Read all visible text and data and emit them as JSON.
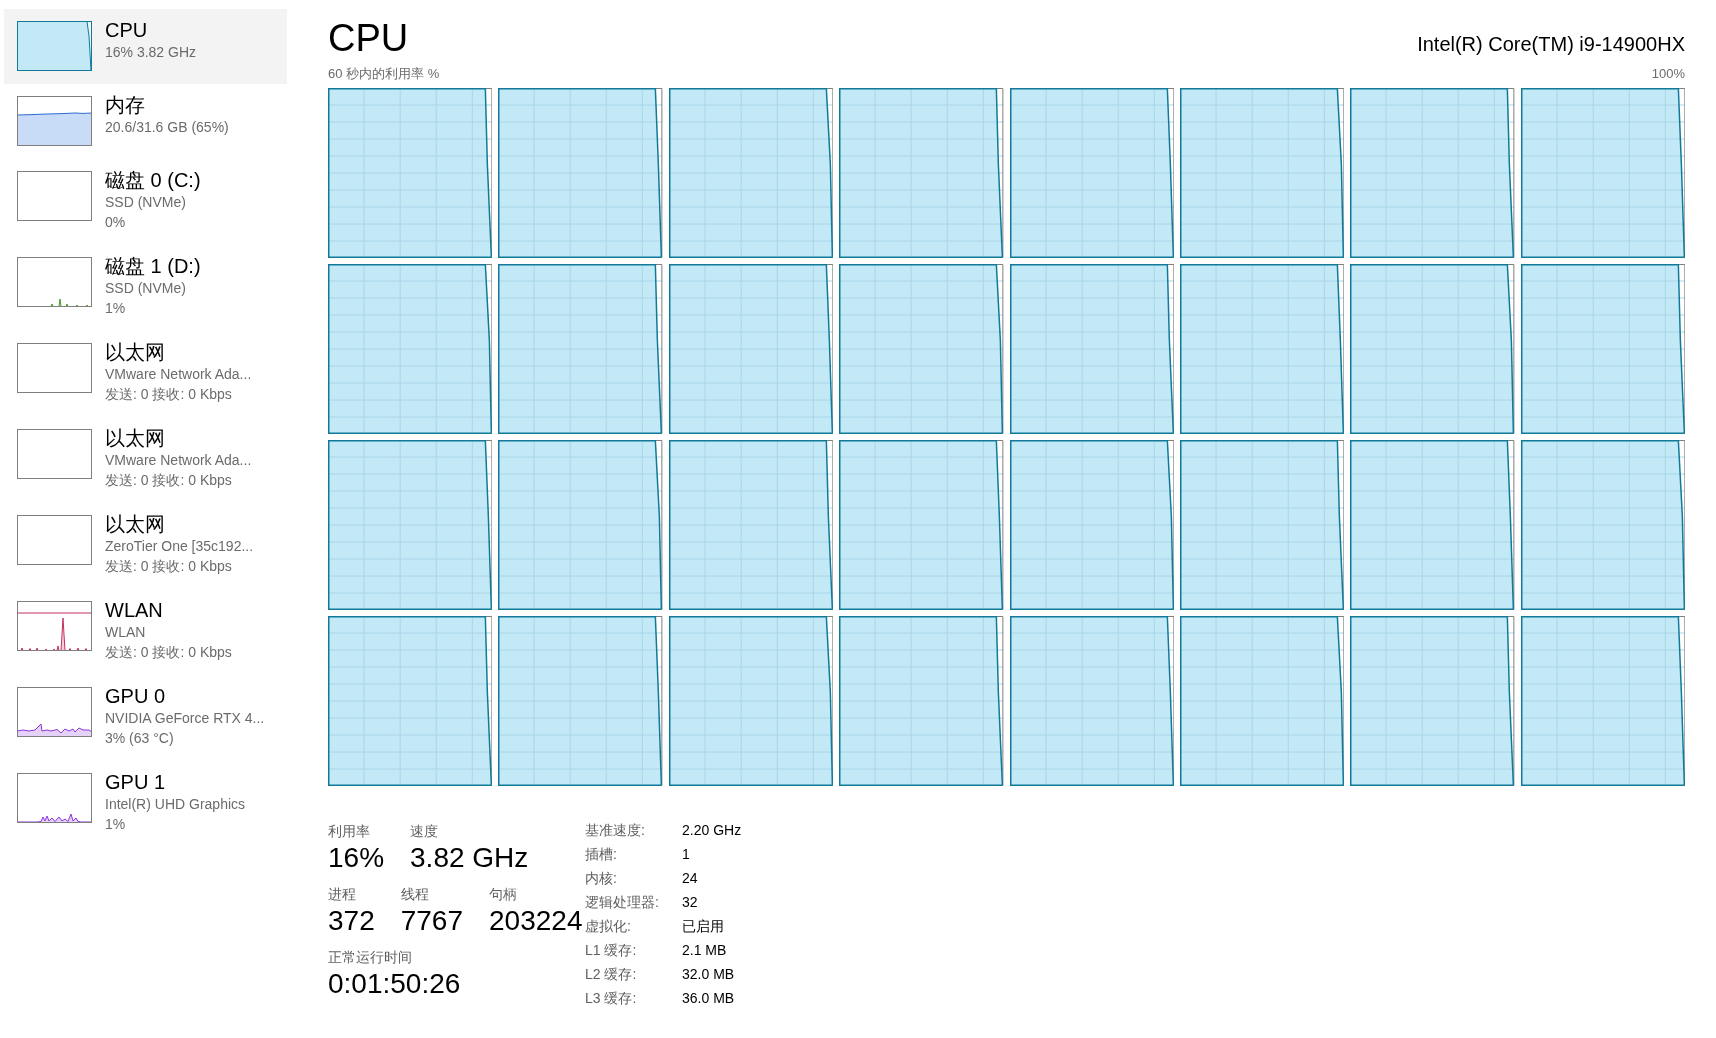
{
  "sidebar": {
    "items": [
      {
        "kind": "cpu",
        "title": "CPU",
        "lines": [
          "16% 3.82 GHz"
        ],
        "selected": true
      },
      {
        "kind": "memory",
        "title": "内存",
        "lines": [
          "20.6/31.6 GB (65%)"
        ],
        "selected": false
      },
      {
        "kind": "disk",
        "title": "磁盘 0 (C:)",
        "lines": [
          "SSD (NVMe)",
          "0%"
        ],
        "selected": false
      },
      {
        "kind": "disk",
        "title": "磁盘 1 (D:)",
        "lines": [
          "SSD (NVMe)",
          "1%"
        ],
        "selected": false
      },
      {
        "kind": "ethernet",
        "title": "以太网",
        "lines": [
          "VMware Network Ada...",
          "发送: 0 接收: 0 Kbps"
        ],
        "selected": false
      },
      {
        "kind": "ethernet",
        "title": "以太网",
        "lines": [
          "VMware Network Ada...",
          "发送: 0 接收: 0 Kbps"
        ],
        "selected": false
      },
      {
        "kind": "ethernet",
        "title": "以太网",
        "lines": [
          "ZeroTier One [35c192...",
          "发送: 0 接收: 0 Kbps"
        ],
        "selected": false
      },
      {
        "kind": "wlan",
        "title": "WLAN",
        "lines": [
          "WLAN",
          "发送: 0 接收: 0 Kbps"
        ],
        "selected": false
      },
      {
        "kind": "gpu",
        "title": "GPU 0",
        "lines": [
          "NVIDIA GeForce RTX 4...",
          "3% (63 °C)"
        ],
        "selected": false
      },
      {
        "kind": "gpu",
        "title": "GPU 1",
        "lines": [
          "Intel(R) UHD Graphics",
          "1%"
        ],
        "selected": false
      }
    ]
  },
  "header": {
    "title": "CPU",
    "processor": "Intel(R) Core(TM) i9-14900HX"
  },
  "utilization_graph": {
    "caption": "60 秒内的利用率 %",
    "max_label": "100%"
  },
  "stats": [
    [
      {
        "label": "利用率",
        "value": "16%"
      },
      {
        "label": "速度",
        "value": "3.82 GHz"
      }
    ],
    [
      {
        "label": "进程",
        "value": "372"
      },
      {
        "label": "线程",
        "value": "7767"
      },
      {
        "label": "句柄",
        "value": "203224"
      }
    ],
    [
      {
        "label": "正常运行时间",
        "value": "0:01:50:26"
      }
    ]
  ],
  "details": [
    {
      "label": "基准速度:",
      "value": "2.20 GHz"
    },
    {
      "label": "插槽:",
      "value": "1"
    },
    {
      "label": "内核:",
      "value": "24"
    },
    {
      "label": "逻辑处理器:",
      "value": "32"
    },
    {
      "label": "虚拟化:",
      "value": "已启用"
    },
    {
      "label": "L1 缓存:",
      "value": "2.1 MB"
    },
    {
      "label": "L2 缓存:",
      "value": "32.0 MB"
    },
    {
      "label": "L3 缓存:",
      "value": "36.0 MB"
    }
  ]
}
